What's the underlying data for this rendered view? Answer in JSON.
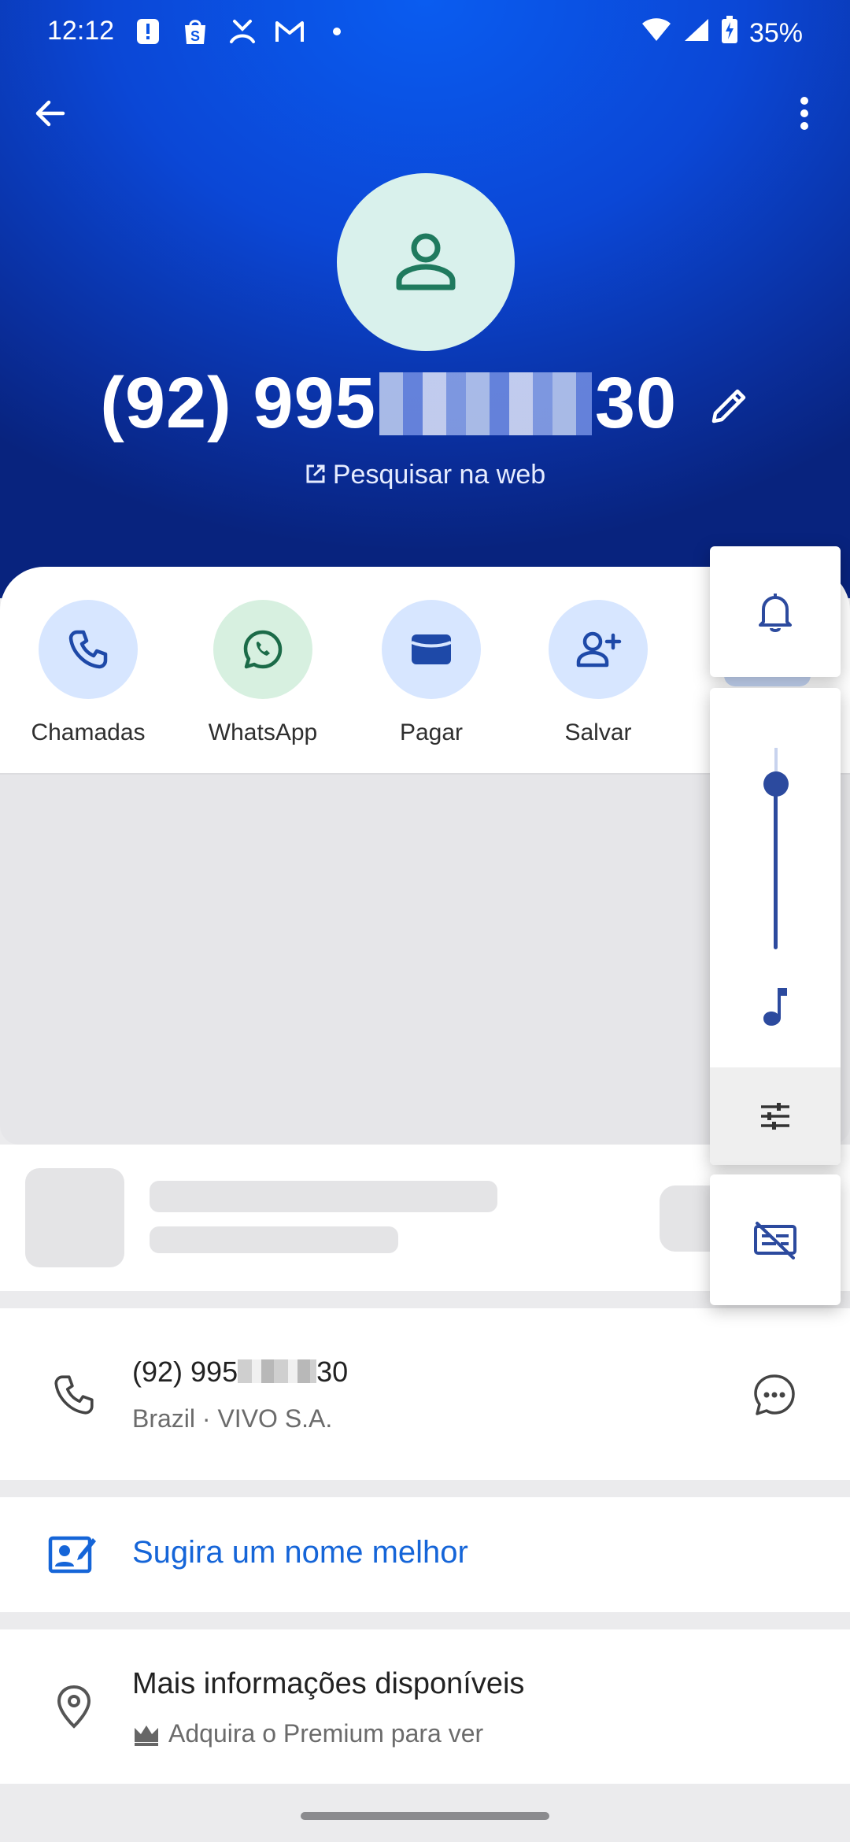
{
  "status_bar": {
    "time": "12:12",
    "battery": "35%",
    "icons": [
      "alert-icon",
      "shopee-icon",
      "missed-call-icon",
      "gmail-icon",
      "dot-icon",
      "wifi-icon",
      "signal-icon",
      "battery-charging-icon"
    ]
  },
  "header": {
    "phone_prefix": "(92) 995",
    "phone_suffix": "30",
    "web_search_label": "Pesquisar na web",
    "avatar_color": "#d9f1ec",
    "gradient_color": "#0b47d6"
  },
  "actions": [
    {
      "label": "Chamadas",
      "icon": "phone-icon"
    },
    {
      "label": "WhatsApp",
      "icon": "whatsapp-icon"
    },
    {
      "label": "Pagar",
      "icon": "wallet-icon"
    },
    {
      "label": "Salvar",
      "icon": "add-person-icon"
    }
  ],
  "number_info": {
    "number_prefix": "(92) 995",
    "number_suffix": "30",
    "carrier": "Brazil · VIVO S.A."
  },
  "suggest": {
    "label": "Sugira um nome melhor",
    "color": "#1565d8"
  },
  "more_info": {
    "title": "Mais informações disponíveis",
    "subtitle": "Adquira o Premium para ver"
  },
  "volume_panel": {
    "ring_level": 0.86,
    "accent": "#2c4a9e"
  }
}
